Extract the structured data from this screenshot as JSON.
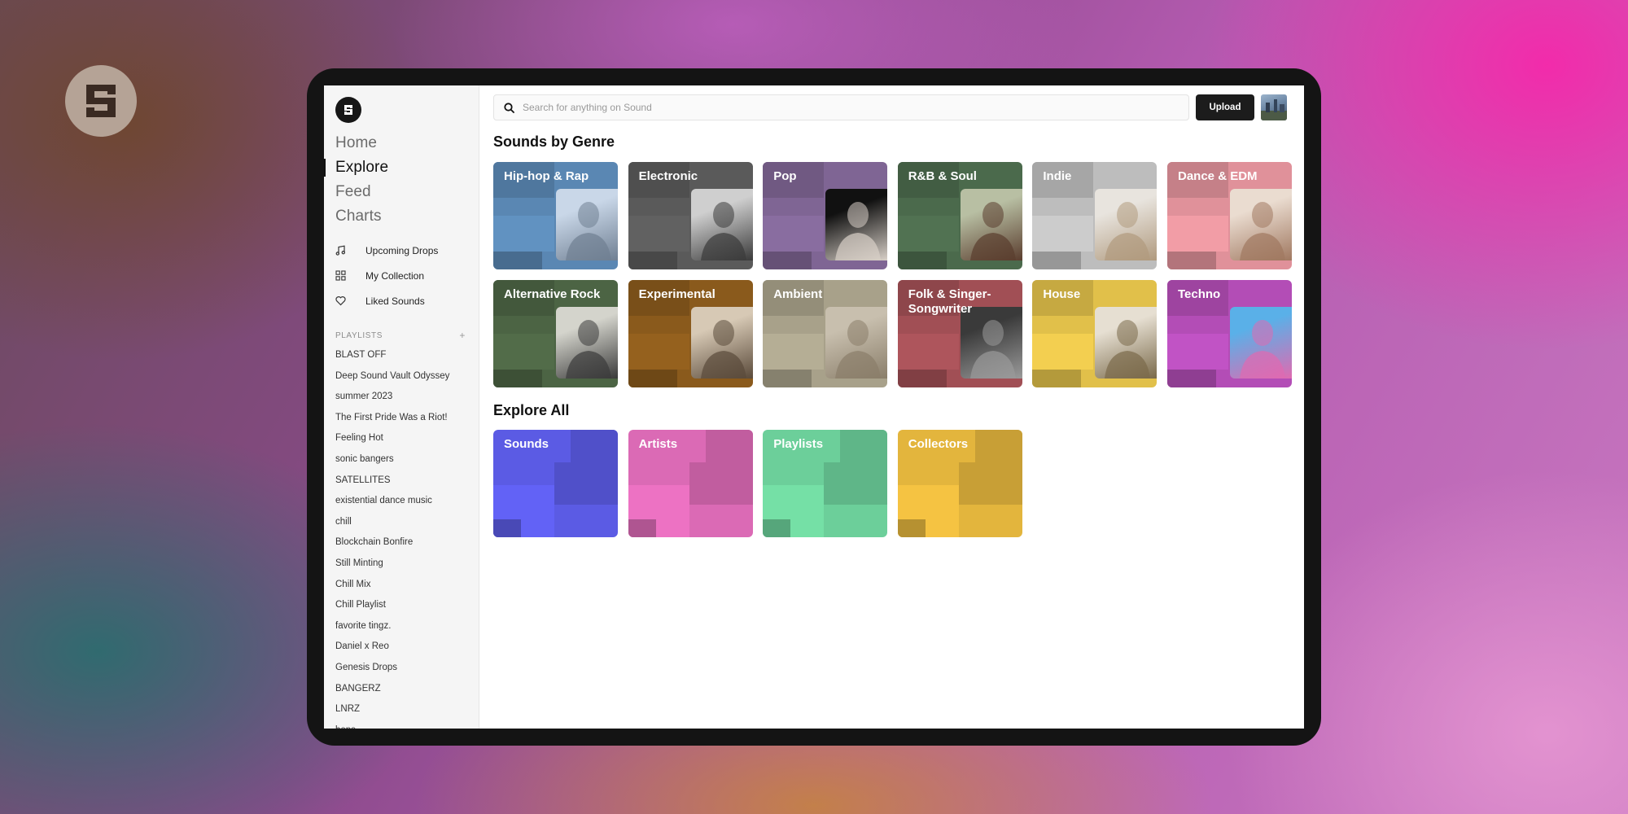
{
  "sidebar": {
    "nav": [
      {
        "label": "Home",
        "active": false
      },
      {
        "label": "Explore",
        "active": true
      },
      {
        "label": "Feed",
        "active": false
      },
      {
        "label": "Charts",
        "active": false
      }
    ],
    "sub_nav": [
      {
        "label": "Upcoming Drops",
        "icon": "music-note-icon"
      },
      {
        "label": "My Collection",
        "icon": "grid-icon"
      },
      {
        "label": "Liked Sounds",
        "icon": "heart-icon"
      }
    ],
    "playlists_heading": "PLAYLISTS",
    "playlists_add": "+",
    "playlists": [
      "BLAST OFF",
      "Deep Sound Vault Odyssey",
      "summer 2023",
      "The First Pride Was a Riot!",
      "Feeling Hot",
      "sonic bangers",
      "SATELLITES",
      "existential dance music",
      "chill",
      "Blockchain Bonfire",
      "Still Minting",
      "Chill Mix",
      "Chill Playlist",
      "favorite tingz.",
      "Daniel x Reo",
      "Genesis Drops",
      "BANGERZ",
      "LNRZ",
      "bops"
    ]
  },
  "header": {
    "search_placeholder": "Search for anything on Sound",
    "upload_label": "Upload"
  },
  "genres_title": "Sounds by Genre",
  "genres": [
    {
      "label": "Hip-hop & Rap",
      "color": "#5a87b3",
      "photo": [
        "#c9d7e8",
        "#6f7f92"
      ]
    },
    {
      "label": "Electronic",
      "color": "#5a5a5a",
      "photo": [
        "#cfcfcf",
        "#3a3a3a"
      ]
    },
    {
      "label": "Pop",
      "color": "#7f6594",
      "photo": [
        "#111111",
        "#d8d0c8"
      ]
    },
    {
      "label": "R&B & Soul",
      "color": "#4b6a4c",
      "photo": [
        "#b8bfa3",
        "#5a3d2e"
      ]
    },
    {
      "label": "Indie",
      "color": "#bdbdbd",
      "photo": [
        "#e8e4de",
        "#b09a7e"
      ]
    },
    {
      "label": "Dance & EDM",
      "color": "#e0919a",
      "photo": [
        "#eadcd0",
        "#a07860"
      ]
    },
    {
      "label": "Alternative Rock",
      "color": "#4c6444",
      "photo": [
        "#d4d4cc",
        "#3a3a3a"
      ]
    },
    {
      "label": "Experimental",
      "color": "#8a5a1c",
      "photo": [
        "#d7c9b5",
        "#5a4a3a"
      ]
    },
    {
      "label": "Ambient",
      "color": "#a8a18a",
      "photo": [
        "#c8bfae",
        "#8a7e6a"
      ]
    },
    {
      "label": "Folk & Singer-Songwriter",
      "color": "#a14f55",
      "photo": [
        "#3a3a3a",
        "#9a9a9a"
      ]
    },
    {
      "label": "House",
      "color": "#e1c04a",
      "photo": [
        "#e6dfd2",
        "#7a6a4a"
      ]
    },
    {
      "label": "Techno",
      "color": "#b34db6",
      "photo": [
        "#5ab0e8",
        "#e06ab0"
      ]
    }
  ],
  "explore_title": "Explore All",
  "explore": [
    {
      "label": "Sounds",
      "color": "#5b5be4"
    },
    {
      "label": "Artists",
      "color": "#db6ab5"
    },
    {
      "label": "Playlists",
      "color": "#6ccf9a"
    },
    {
      "label": "Collectors",
      "color": "#e3b53d"
    }
  ]
}
